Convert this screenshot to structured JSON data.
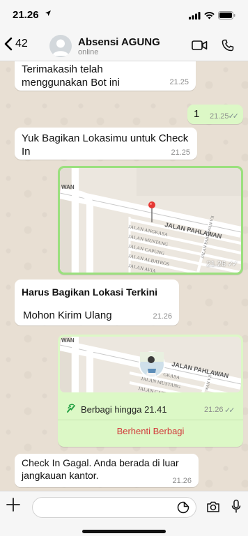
{
  "status_bar": {
    "time": "21.26"
  },
  "header": {
    "back_count": "42",
    "contact_name": "Absensi AGUNG",
    "contact_status": "online"
  },
  "messages": [
    {
      "direction": "in",
      "text": "Terimakasih telah menggunakan Bot ini",
      "time": "21.25"
    },
    {
      "direction": "out",
      "text": "1",
      "time": "21.25",
      "read": true
    },
    {
      "direction": "in",
      "text": "Yuk Bagikan Lokasimu untuk Check In",
      "time": "21.25"
    },
    {
      "direction": "out",
      "type": "location",
      "time": "21.26",
      "read": true,
      "map_labels": [
        "WAN",
        "JALAN PAHLAWAN",
        "JALAN ANGKASA",
        "JALAN MUSTANG",
        "JALAN CAPUNG",
        "JALAN ALBATROS",
        "JALAN AVIA",
        "JALAN PAHLAWAN VII"
      ]
    },
    {
      "direction": "in",
      "title": "Harus Bagikan Lokasi Terkini",
      "text": "Mohon Kirim Ulang",
      "time": "21.26"
    },
    {
      "direction": "out",
      "type": "live_location",
      "time": "21.26",
      "read": true,
      "map_labels": [
        "WAN",
        "JALAN PAHLAWAN",
        "GKASA",
        "JALAN MUSTANG",
        "JALAN CAPUNG",
        "WAN VII"
      ],
      "caption": "Berbagi hingga 21.41",
      "stop_label": "Berhenti Berbagi"
    },
    {
      "direction": "in",
      "text": "Check In Gagal. Anda berada di luar jangkauan kantor.",
      "time": "21.26"
    }
  ],
  "composer": {
    "value": "",
    "placeholder": ""
  },
  "colors": {
    "incoming": "#ffffff",
    "outgoing": "#dcf8c6",
    "stop_red": "#d23b3b",
    "map_border": "#9be07e",
    "pin_red": "#e53935"
  }
}
